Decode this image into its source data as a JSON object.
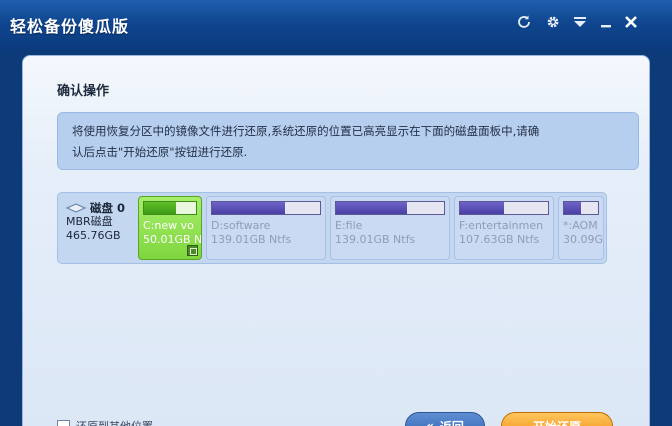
{
  "window": {
    "title": "轻松备份傻瓜版"
  },
  "titlebar_buttons": [
    {
      "name": "refresh-icon"
    },
    {
      "name": "gear-icon"
    },
    {
      "name": "dropdown-icon"
    },
    {
      "name": "minimize-icon"
    },
    {
      "name": "close-icon"
    }
  ],
  "section": {
    "title": "确认操作"
  },
  "info": {
    "line1": "将使用恢复分区中的镜像文件进行还原,系统还原的位置已高亮显示在下面的磁盘面板中,请确",
    "line2": "认后点击\"开始还原\"按钮进行还原."
  },
  "disk": {
    "name": "磁盘 0",
    "type": "MBR磁盘",
    "size": "465.76GB",
    "partitions": [
      {
        "label": "C:new vo",
        "size": "50.01GB N",
        "used": 0.62,
        "selected": true
      },
      {
        "label": "D:software",
        "size": "139.01GB Ntfs",
        "used": 0.68,
        "selected": false
      },
      {
        "label": "E:file",
        "size": "139.01GB Ntfs",
        "used": 0.66,
        "selected": false
      },
      {
        "label": "F:entertainmen",
        "size": "107.63GB Ntfs",
        "used": 0.5,
        "selected": false
      },
      {
        "label": "*:AOM",
        "size": "30.09G",
        "used": 0.5,
        "selected": false
      }
    ]
  },
  "footer": {
    "checkbox_label": "还原到其他位置",
    "back_label": "返回",
    "start_label": "开始还原"
  },
  "colors": {
    "titlebar": "#0f468f",
    "selected_partition": "#7fd63e",
    "usage_bar": "#4a3fa4",
    "start_button": "#f08f17",
    "back_button": "#2f63b3"
  }
}
